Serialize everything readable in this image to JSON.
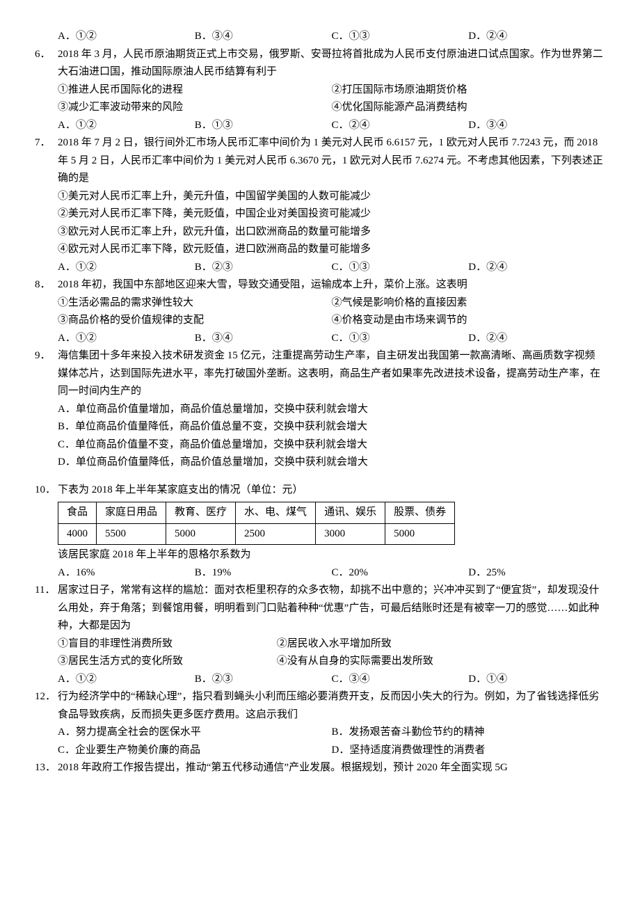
{
  "q5opts": {
    "a": "A．①②",
    "b": "B．③④",
    "c": "C．①③",
    "d": "D．②④"
  },
  "q6": {
    "stem": "2018 年 3 月，人民币原油期货正式上市交易，俄罗斯、安哥拉将首批成为人民币支付原油进口试点国家。作为世界第二大石油进口国，推动国际原油人民币结算有利于",
    "c1": "①推进人民币国际化的进程",
    "c2": "②打压国际市场原油期货价格",
    "c3": "③减少汇率波动带来的风险",
    "c4": "④优化国际能源产品消费结构",
    "a": "A．①②",
    "b": "B．①③",
    "c": "C．②④",
    "d": "D．③④"
  },
  "q7": {
    "stem": "2018 年 7 月 2 日，银行间外汇市场人民币汇率中间价为 1 美元对人民币 6.6157 元，1 欧元对人民币 7.7243 元，而 2018 年 5 月 2 日，人民币汇率中间价为 1 美元对人民币 6.3670 元，1 欧元对人民币 7.6274 元。不考虑其他因素，下列表述正确的是",
    "c1": "①美元对人民币汇率上升，美元升值，中国留学美国的人数可能减少",
    "c2": "②美元对人民币汇率下降，美元贬值，中国企业对美国投资可能减少",
    "c3": "③欧元对人民币汇率上升，欧元升值，出口欧洲商品的数量可能增多",
    "c4": "④欧元对人民币汇率下降，欧元贬值，进口欧洲商品的数量可能增多",
    "a": "A．①②",
    "b": "B．②③",
    "c": "C．①③",
    "d": "D．②④"
  },
  "q8": {
    "stem": "2018 年初，我国中东部地区迎来大雪，导致交通受阻，运输成本上升，菜价上涨。这表明",
    "c1": "①生活必需品的需求弹性较大",
    "c2": "②气候是影响价格的直接因素",
    "c3": "③商品价格的受价值规律的支配",
    "c4": "④价格变动是由市场来调节的",
    "a": "A．①②",
    "b": "B．③④",
    "c": "C．①③",
    "d": "D．②④"
  },
  "q9": {
    "stem": "海信集团十多年来投入技术研发资金 15 亿元，注重提高劳动生产率，自主研发出我国第一款高清晰、高画质数字视频媒体芯片，达到国际先进水平，率先打破国外垄断。这表明，商品生产者如果率先改进技术设备，提高劳动生产率，在同一时间内生产的",
    "a": "A．单位商品价值量增加，商品价值总量增加，交换中获利就会增大",
    "b": "B．单位商品价值量降低，商品价值总量不变，交换中获利就会增大",
    "c": "C．单位商品价值量不变，商品价值总量增加，交换中获利就会增大",
    "d": "D．单位商品价值量降低，商品价值总量增加，交换中获利就会增大"
  },
  "q10": {
    "stem": "下表为 2018 年上半年某家庭支出的情况（单位：元）",
    "h1": "食品",
    "h2": "家庭日用品",
    "h3": "教育、医疗",
    "h4": "水、电、煤气",
    "h5": "通讯、娱乐",
    "h6": "股票、债券",
    "v1": "4000",
    "v2": "5500",
    "v3": "5000",
    "v4": "2500",
    "v5": "3000",
    "v6": "5000",
    "sub": "该居民家庭 2018 年上半年的恩格尔系数为",
    "a": "A．16%",
    "b": "B．19%",
    "c": "C．20%",
    "d": "D．25%"
  },
  "q11": {
    "stem": "居家过日子，常常有这样的尴尬：面对衣柜里积存的众多衣物，却挑不出中意的；兴冲冲买到了“便宜货”，却发现没什么用处，弃于角落；到餐馆用餐，明明看到门口贴着种种“优惠”广告，可最后结账时还是有被宰一刀的感觉……如此种种，大都是因为",
    "c1": "①盲目的非理性消费所致",
    "c2": "②居民收入水平增加所致",
    "c3": "③居民生活方式的变化所致",
    "c4": "④没有从自身的实际需要出发所致",
    "a": "A．①②",
    "b": "B．②③",
    "c": "C．③④",
    "d": "D．①④"
  },
  "q12": {
    "stem": "行为经济学中的“稀缺心理”，指只看到蝇头小利而压缩必要消费开支，反而因小失大的行为。例如，为了省钱选择低劣食品导致疾病，反而损失更多医疗费用。这启示我们",
    "a": "A．努力提高全社会的医保水平",
    "b": "B．发扬艰苦奋斗勤俭节约的精神",
    "c": "C．企业要生产物美价廉的商品",
    "d": "D．坚持适度消费做理性的消费者"
  },
  "q13": {
    "stem": "2018 年政府工作报告提出，推动“第五代移动通信”产业发展。根据规划，预计 2020 年全面实现 5G"
  }
}
